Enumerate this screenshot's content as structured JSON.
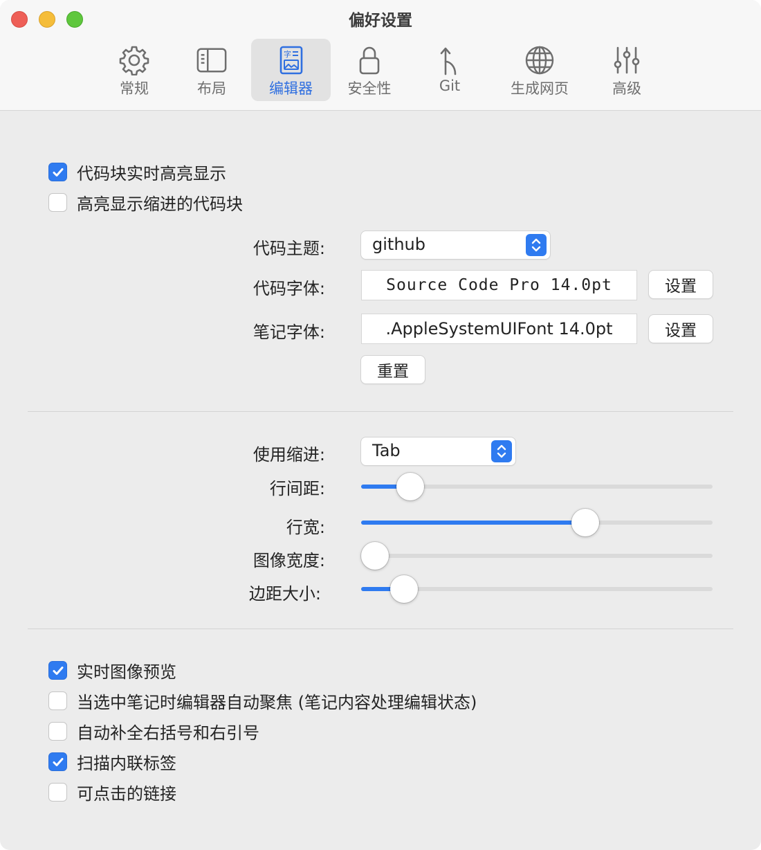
{
  "window": {
    "title": "偏好设置"
  },
  "toolbar": {
    "tabs": [
      {
        "label": "常规",
        "icon": "gear-icon"
      },
      {
        "label": "布局",
        "icon": "sidebar-layout-icon"
      },
      {
        "label": "编辑器",
        "icon": "editor-icon",
        "active": true
      },
      {
        "label": "安全性",
        "icon": "lock-icon"
      },
      {
        "label": "Git",
        "icon": "git-branch-icon"
      },
      {
        "label": "生成网页",
        "icon": "globe-icon"
      },
      {
        "label": "高级",
        "icon": "sliders-icon"
      }
    ]
  },
  "section1": {
    "checkboxes": [
      {
        "label": "代码块实时高亮显示",
        "checked": true
      },
      {
        "label": "高亮显示缩进的代码块",
        "checked": false
      }
    ],
    "code_theme": {
      "label": "代码主题:",
      "value": "github"
    },
    "code_font": {
      "label": "代码字体:",
      "value": "Source Code Pro 14.0pt",
      "button": "设置"
    },
    "note_font": {
      "label": "笔记字体:",
      "value": ".AppleSystemUIFont 14.0pt",
      "button": "设置"
    },
    "reset_button": "重置"
  },
  "section2": {
    "indent": {
      "label": "使用缩进:",
      "value": "Tab"
    },
    "sliders": [
      {
        "label": "行间距:",
        "value": 0.11
      },
      {
        "label": "行宽:",
        "value": 0.65
      },
      {
        "label": "图像宽度:",
        "value": 0.0
      },
      {
        "label": "边距大小:",
        "value": 0.09
      }
    ]
  },
  "section3": {
    "checkboxes": [
      {
        "label": "实时图像预览",
        "checked": true
      },
      {
        "label": "当选中笔记时编辑器自动聚焦 (笔记内容处理编辑状态)",
        "checked": false
      },
      {
        "label": "自动补全右括号和右引号",
        "checked": false
      },
      {
        "label": "扫描内联标签",
        "checked": true
      },
      {
        "label": "可点击的链接",
        "checked": false
      }
    ]
  },
  "colors": {
    "accent": "#2f7bf0",
    "window_bg": "#ececec",
    "toolbar_bg": "#f7f7f7",
    "close": "#ee5f57",
    "minimize": "#f5bd3a",
    "maximize": "#5fc73d"
  }
}
